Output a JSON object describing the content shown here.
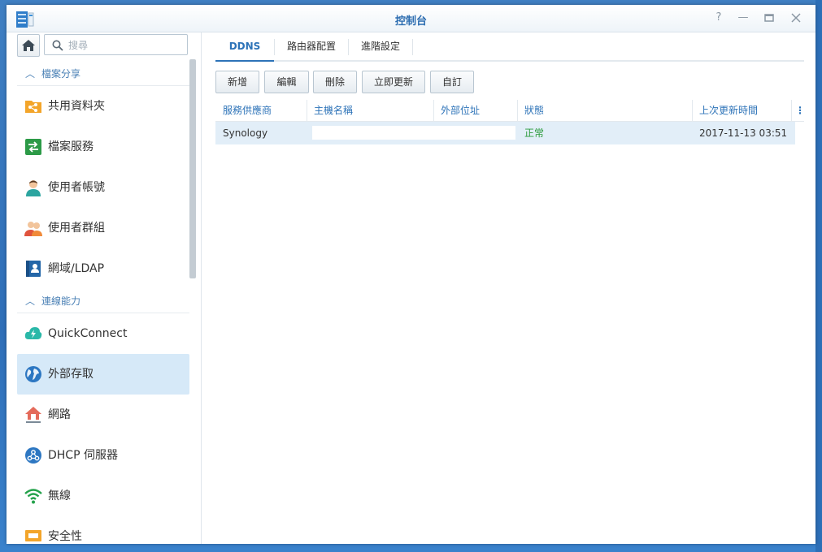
{
  "window": {
    "title": "控制台"
  },
  "search": {
    "placeholder": "搜尋"
  },
  "sidebar": {
    "sections": [
      {
        "label": "檔案分享",
        "items": [
          {
            "label": "共用資料夾",
            "icon": "share-folder-icon"
          },
          {
            "label": "檔案服務",
            "icon": "file-services-icon"
          },
          {
            "label": "使用者帳號",
            "icon": "user-icon"
          },
          {
            "label": "使用者群組",
            "icon": "group-icon"
          },
          {
            "label": "網域/LDAP",
            "icon": "directory-icon"
          }
        ]
      },
      {
        "label": "連線能力",
        "items": [
          {
            "label": "QuickConnect",
            "icon": "quickconnect-icon"
          },
          {
            "label": "外部存取",
            "icon": "globe-icon",
            "active": true
          },
          {
            "label": "網路",
            "icon": "network-house-icon"
          },
          {
            "label": "DHCP 伺服器",
            "icon": "dhcp-icon"
          },
          {
            "label": "無線",
            "icon": "wifi-icon"
          },
          {
            "label": "安全性",
            "icon": "security-icon"
          }
        ]
      }
    ]
  },
  "tabs": [
    {
      "label": "DDNS",
      "active": true
    },
    {
      "label": "路由器配置"
    },
    {
      "label": "進階設定"
    }
  ],
  "toolbar": {
    "add": "新增",
    "edit": "編輯",
    "delete": "刪除",
    "update_now": "立即更新",
    "customize": "自訂"
  },
  "grid": {
    "columns": [
      "服務供應商",
      "主機名稱",
      "外部位址",
      "狀態",
      "上次更新時間"
    ],
    "rows": [
      {
        "provider": "Synology",
        "hostname": "",
        "external": "",
        "status": "正常",
        "last_update": "2017-11-13 03:51"
      }
    ]
  },
  "colors": {
    "accent": "#2d73b8",
    "status_ok": "#2b9a3b",
    "selected_row": "#e2eef8",
    "active_nav": "#d6e9f8"
  }
}
